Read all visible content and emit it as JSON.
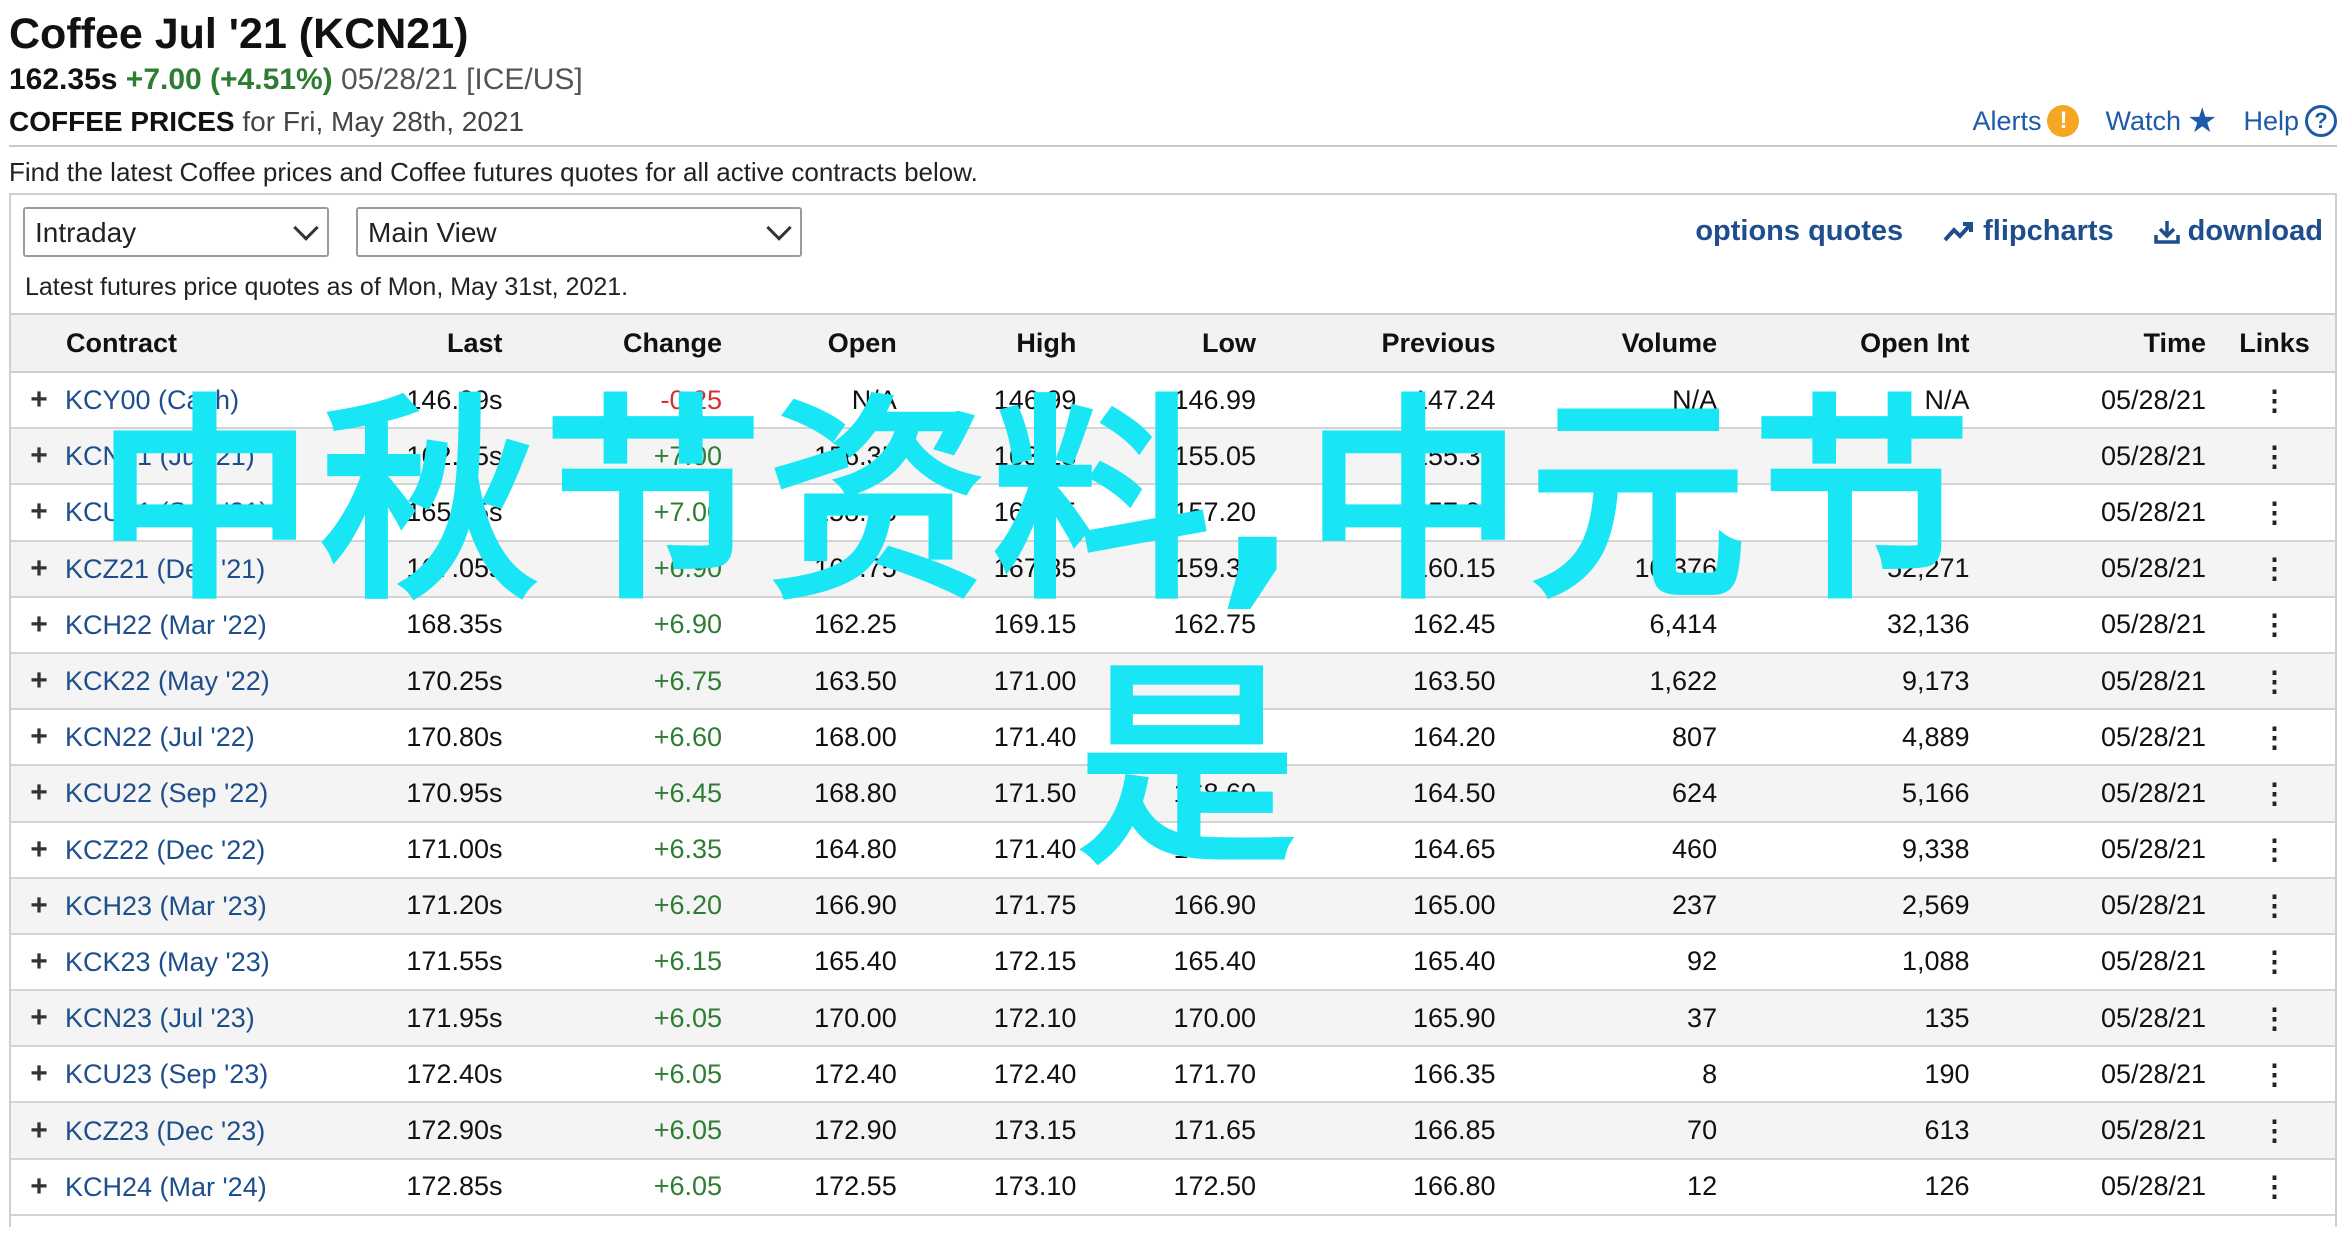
{
  "header": {
    "title": "Coffee Jul '21 (KCN21)",
    "price": "162.35s",
    "change": "+7.00 (+4.51%)",
    "date_exchange": "05/28/21 [ICE/US]",
    "subtitle_bold": "COFFEE PRICES",
    "subtitle_rest": "for Fri, May 28th, 2021",
    "links": {
      "alerts": "Alerts",
      "watch": "Watch",
      "help": "Help"
    }
  },
  "intro": "Find the latest Coffee prices and Coffee futures quotes for all active contracts below.",
  "controls": {
    "select1": "Intraday",
    "select2": "Main View",
    "tools": {
      "options": "options quotes",
      "flipcharts": "flipcharts",
      "download": "download"
    },
    "asof": "Latest futures price quotes as of Mon, May 31st, 2021."
  },
  "table": {
    "headers": [
      "Contract",
      "Last",
      "Change",
      "Open",
      "High",
      "Low",
      "Previous",
      "Volume",
      "Open Int",
      "Time",
      "Links"
    ],
    "rows": [
      [
        "KCY00 (Cash)",
        "146.99s",
        "-0.25",
        "N/A",
        "146.99",
        "146.99",
        "147.24",
        "N/A",
        "N/A",
        "05/28/21"
      ],
      [
        "KCN21 (Jul '21)",
        "162.35s",
        "+7.00",
        "156.35",
        "163.15",
        "155.05",
        "155.35",
        "",
        "",
        "05/28/21"
      ],
      [
        "KCU21 (Sep '21)",
        "165.05s",
        "+7.00",
        "158.25",
        "165.75",
        "157.20",
        "157.95",
        "",
        "",
        "05/28/21"
      ],
      [
        "KCZ21 (Dec '21)",
        "167.05s",
        "+6.90",
        "160.75",
        "167.85",
        "159.30",
        "160.15",
        "10,376",
        "52,271",
        "05/28/21"
      ],
      [
        "KCH22 (Mar '22)",
        "168.35s",
        "+6.90",
        "162.25",
        "169.15",
        "162.75",
        "162.45",
        "6,414",
        "32,136",
        "05/28/21"
      ],
      [
        "KCK22 (May '22)",
        "170.25s",
        "+6.75",
        "163.50",
        "171.00",
        "",
        "163.50",
        "1,622",
        "9,173",
        "05/28/21"
      ],
      [
        "KCN22 (Jul '22)",
        "170.80s",
        "+6.60",
        "168.00",
        "171.40",
        "",
        "164.20",
        "807",
        "4,889",
        "05/28/21"
      ],
      [
        "KCU22 (Sep '22)",
        "170.95s",
        "+6.45",
        "168.80",
        "171.50",
        "168.60",
        "164.50",
        "624",
        "5,166",
        "05/28/21"
      ],
      [
        "KCZ22 (Dec '22)",
        "171.00s",
        "+6.35",
        "164.80",
        "171.40",
        "164.80",
        "164.65",
        "460",
        "9,338",
        "05/28/21"
      ],
      [
        "KCH23 (Mar '23)",
        "171.20s",
        "+6.20",
        "166.90",
        "171.75",
        "166.90",
        "165.00",
        "237",
        "2,569",
        "05/28/21"
      ],
      [
        "KCK23 (May '23)",
        "171.55s",
        "+6.15",
        "165.40",
        "172.15",
        "165.40",
        "165.40",
        "92",
        "1,088",
        "05/28/21"
      ],
      [
        "KCN23 (Jul '23)",
        "171.95s",
        "+6.05",
        "170.00",
        "172.10",
        "170.00",
        "165.90",
        "37",
        "135",
        "05/28/21"
      ],
      [
        "KCU23 (Sep '23)",
        "172.40s",
        "+6.05",
        "172.40",
        "172.40",
        "171.70",
        "166.35",
        "8",
        "190",
        "05/28/21"
      ],
      [
        "KCZ23 (Dec '23)",
        "172.90s",
        "+6.05",
        "172.90",
        "173.15",
        "171.65",
        "166.85",
        "70",
        "613",
        "05/28/21"
      ],
      [
        "KCH24 (Mar '24)",
        "172.85s",
        "+6.05",
        "172.55",
        "173.10",
        "172.50",
        "166.80",
        "12",
        "126",
        "05/28/21"
      ]
    ]
  },
  "overlay": {
    "line1": "中秋节资料,中元节",
    "line2": "是"
  },
  "colors": {
    "link": "#1e4e8c",
    "positive": "#2e7d32",
    "negative": "#d32f2f",
    "overlay": "#19e6f5"
  }
}
